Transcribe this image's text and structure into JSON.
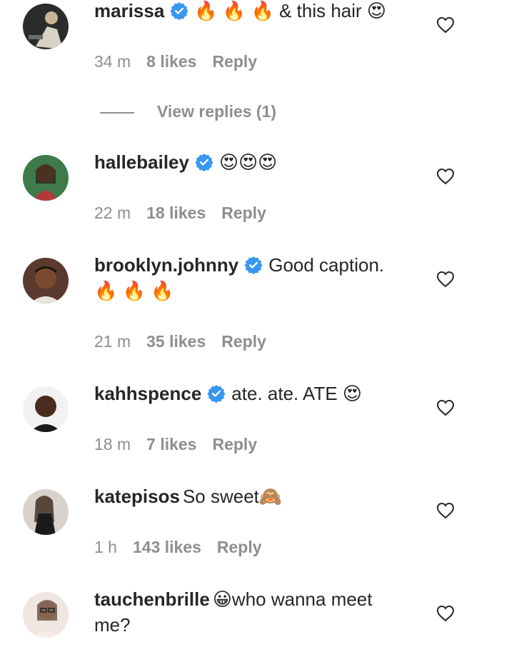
{
  "comments": [
    {
      "username": "marissa",
      "verified": true,
      "text": "🔥 🔥 🔥 & this hair 😍",
      "time": "34 m",
      "likes": "8 likes",
      "reply": "Reply",
      "view_replies": "View replies (1)"
    },
    {
      "username": "hallebailey",
      "verified": true,
      "text": "😍😍😍",
      "time": "22 m",
      "likes": "18 likes",
      "reply": "Reply"
    },
    {
      "username": "brooklyn.johnny",
      "verified": true,
      "text": "Good caption. 🔥 🔥 🔥",
      "time": "21 m",
      "likes": "35 likes",
      "reply": "Reply"
    },
    {
      "username": "kahhspence",
      "verified": true,
      "text": "ate. ate. ATE 😍",
      "time": "18 m",
      "likes": "7 likes",
      "reply": "Reply"
    },
    {
      "username": "katepisos",
      "verified": false,
      "text": "So sweet🙈",
      "time": "1 h",
      "likes": "143 likes",
      "reply": "Reply"
    },
    {
      "username": "tauchenbrille",
      "verified": false,
      "text": "😀who wanna meet me?"
    }
  ],
  "colors": {
    "text": "#262626",
    "muted": "#8e8e8e",
    "verified_blue": "#3897f0"
  },
  "icons": {
    "like": "heart-outline-icon",
    "verified": "verified-badge-icon"
  }
}
